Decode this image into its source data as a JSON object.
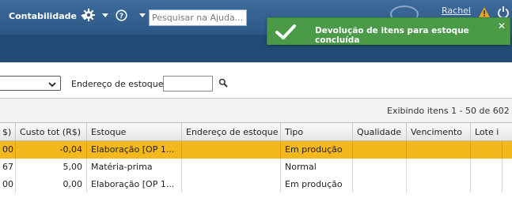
{
  "header": {
    "menu_label": "Contabilidade",
    "search": {
      "placeholder": "Pesquisar na Ajuda..."
    },
    "user": "Rachel"
  },
  "toast": {
    "message": "Devolução de itens para estoque concluída",
    "close": "✕",
    "color": "#4a9a47"
  },
  "filters": {
    "address_label": "Endereço de estoque",
    "address_value": ""
  },
  "pagination": {
    "summary": "Exibindo itens 1 - 50 de 602"
  },
  "table": {
    "columns": [
      "$)",
      "Custo tot (R$)",
      "Estoque",
      "Endereço de estoque",
      "Tipo",
      "Qualidade",
      "Vencimento",
      "Lote i"
    ],
    "rows": [
      {
        "c0": "00",
        "c1": "-0,04",
        "c2": "Elaboração [OP 1...",
        "c3": "",
        "c4": "Em produção",
        "c5": "",
        "c6": "",
        "c7": "",
        "selected": true
      },
      {
        "c0": "67",
        "c1": "5,00",
        "c2": "Matéria-prima",
        "c3": "",
        "c4": "Normal",
        "c5": "",
        "c6": "",
        "c7": "",
        "selected": false
      },
      {
        "c0": "00",
        "c1": "0,00",
        "c2": "Elaboração [OP 1...",
        "c3": "",
        "c4": "Em produção",
        "c5": "",
        "c6": "",
        "c7": "",
        "selected": false
      }
    ]
  },
  "colors": {
    "header": "#2c5886",
    "strip": "#214b74",
    "selected_row": "#f4b81c"
  }
}
